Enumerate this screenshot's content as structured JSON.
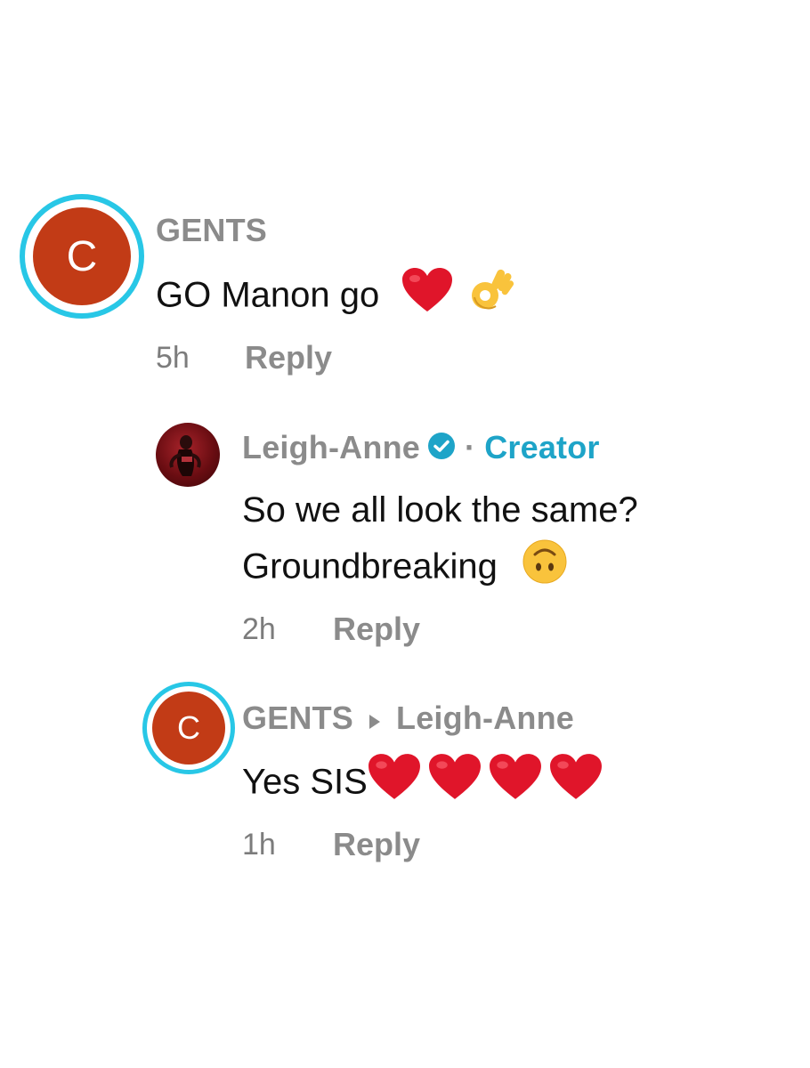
{
  "comments": [
    {
      "avatar_letter": "C",
      "username": "GENTS",
      "text": "GO Manon go",
      "emojis": [
        "heart-emoji",
        "ok-hand-emoji"
      ],
      "time": "5h",
      "reply_label": "Reply"
    },
    {
      "username": "Leigh-Anne",
      "verified_icon": "verified-check-icon",
      "separator": "·",
      "badge": "Creator",
      "text_line1": "So we all look the same?",
      "text_line2": "Groundbreaking",
      "emojis": [
        "upside-down-face-emoji"
      ],
      "time": "2h",
      "reply_label": "Reply"
    },
    {
      "avatar_letter": "C",
      "username": "GENTS",
      "reply_to": "Leigh-Anne",
      "text": "Yes SIS",
      "emojis": [
        "heart-emoji",
        "heart-emoji",
        "heart-emoji",
        "heart-emoji"
      ],
      "time": "1h",
      "reply_label": "Reply"
    }
  ],
  "colors": {
    "ring": "#28c7e6",
    "avatar_bg": "#c23b16",
    "creator": "#1ea4c8",
    "heart": "#e0152a",
    "muted": "#8b8b8b"
  }
}
